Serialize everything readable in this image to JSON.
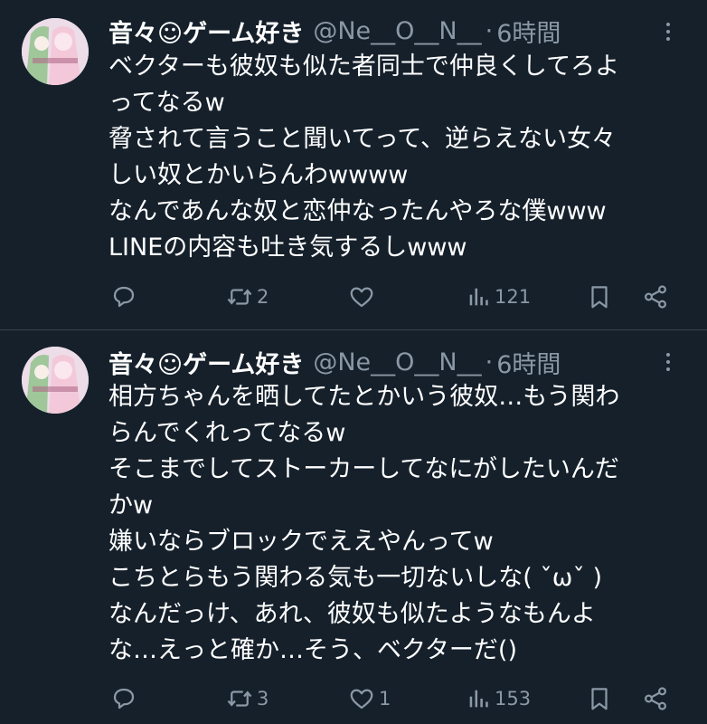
{
  "colors": {
    "background": "#15202b",
    "text": "#ffffff",
    "muted": "#8b98a5",
    "divider": "#38444d"
  },
  "tweets": [
    {
      "author": {
        "display_name": "音々☺ゲーム好き",
        "handle": "@Ne__O__N__",
        "separator": "·",
        "time": "6時間"
      },
      "lines": [
        "ベクターも彼奴も似た者同士で仲良くしてろよ",
        "ってなるw",
        "脅されて言うこと聞いてって、逆らえない女々",
        "しい奴とかいらんわwwww",
        "なんであんな奴と恋仲なったんやろな僕www",
        "LINEの内容も吐き気するしwww"
      ],
      "stats": {
        "replies": "",
        "retweets": "2",
        "likes": "",
        "views": "121"
      }
    },
    {
      "author": {
        "display_name": "音々☺ゲーム好き",
        "handle": "@Ne__O__N__",
        "separator": "·",
        "time": "6時間"
      },
      "lines": [
        "相方ちゃんを晒してたとかいう彼奴…もう関わ",
        "らんでくれってなるw",
        "そこまでしてストーカーしてなにがしたいんだ",
        "かw",
        "嫌いならブロックでええやんってw",
        "こちとらもう関わる気も一切ないしな( ˇωˇ )",
        "なんだっけ、あれ、彼奴も似たようなもんよ",
        "な…えっと確か…そう、ベクターだ()"
      ],
      "stats": {
        "replies": "",
        "retweets": "3",
        "likes": "1",
        "views": "153"
      }
    }
  ],
  "icons": {
    "avatar": "avatar-image",
    "more": "more-options-icon",
    "reply": "reply-icon",
    "retweet": "retweet-icon",
    "like": "heart-icon",
    "views": "views-chart-icon",
    "bookmark": "bookmark-icon",
    "share": "share-icon"
  }
}
